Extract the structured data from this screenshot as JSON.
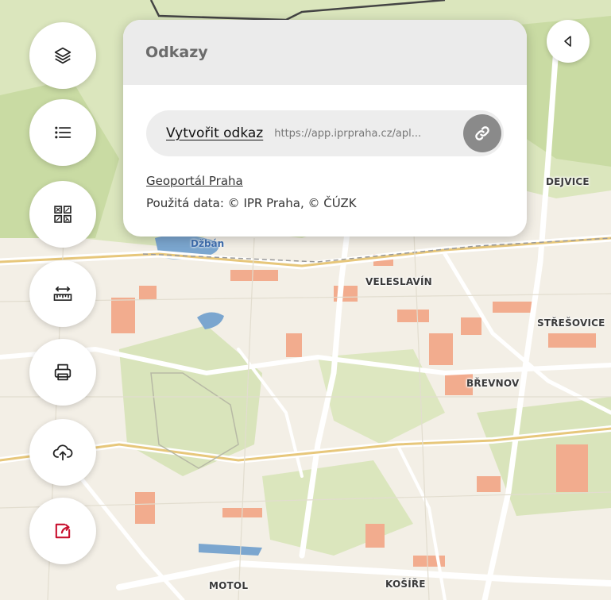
{
  "map": {
    "labels": {
      "dejvice": "DEJVICE",
      "veleslavin": "VELESLAVÍN",
      "stresovice": "STŘEŠOVICE",
      "brevnov": "BŘEVNOV",
      "motol": "MOTOL",
      "kosire": "KOŠÍŘE",
      "dzban": "Džbán"
    },
    "colors": {
      "land": "#f3efe6",
      "green": "#d6e3b4",
      "forest": "#c3d69a",
      "water": "#7ba6cf",
      "building": "#f2a98a",
      "road": "#ffffff"
    }
  },
  "toolbar": {
    "buttons": [
      {
        "name": "layers-button",
        "icon": "layers-icon"
      },
      {
        "name": "legend-button",
        "icon": "list-icon"
      },
      {
        "name": "qr-code-button",
        "icon": "qr-code-icon"
      },
      {
        "name": "measure-button",
        "icon": "ruler-icon"
      },
      {
        "name": "print-button",
        "icon": "printer-icon"
      },
      {
        "name": "upload-button",
        "icon": "cloud-upload-icon"
      },
      {
        "name": "share-button",
        "icon": "share-icon",
        "color": "#c8102e"
      }
    ]
  },
  "panel": {
    "title": "Odkazy",
    "create_link_label": "Vytvořit odkaz",
    "url_value": "https://app.iprpraha.cz/apl...",
    "geoportal_label": "Geoportál Praha",
    "data_credit": "Použitá data: © IPR Praha, © ČÚZK"
  },
  "collapse": {
    "icon": "triangle-left-icon"
  }
}
